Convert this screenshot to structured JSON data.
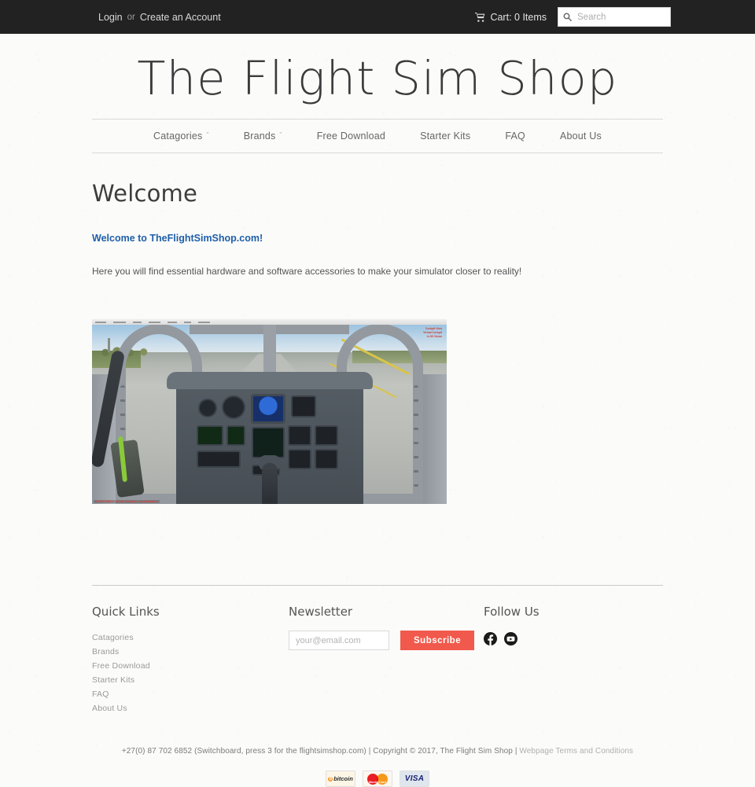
{
  "topbar": {
    "login_label": "Login",
    "separator": "or",
    "create_account_label": "Create an Account",
    "cart_label": "Cart: 0 Items",
    "cart_icon": "shopping-cart-icon",
    "search_icon": "search-icon",
    "search_placeholder": "Search",
    "search_value": "",
    "background_color": "#222222"
  },
  "brand": {
    "title": "The Flight Sim Shop"
  },
  "nav": {
    "items": [
      {
        "label": "Catagories",
        "has_caret": true,
        "caret": "ˇ"
      },
      {
        "label": "Brands",
        "has_caret": true,
        "caret": "ˇ"
      },
      {
        "label": "Free Download",
        "has_caret": false,
        "caret": ""
      },
      {
        "label": "Starter Kits",
        "has_caret": false,
        "caret": ""
      },
      {
        "label": "FAQ",
        "has_caret": false,
        "caret": ""
      },
      {
        "label": "About Us",
        "has_caret": false,
        "caret": ""
      }
    ]
  },
  "main": {
    "page_title": "Welcome",
    "lead_link": "Welcome to TheFlightSimShop.com!",
    "lead_link_color": "#1f5fa8",
    "intro_text": "Here you will find essential hardware and software accessories to make your simulator closer to reality!",
    "screenshot": {
      "alt": "Flight simulator jet cockpit view on runway",
      "watermark_top_right": "Cockpit View\nVirtual Cockpit\nin 3D Vision",
      "watermark_bottom_left": "FLIGHT SIM X  ·  Photo Realistic  ·  by Simulation",
      "menu_items": [
        "Flights",
        "Vehicles",
        "World",
        "Options",
        "Views",
        "Help",
        "Add-ons"
      ]
    }
  },
  "footer": {
    "quick_links": {
      "title": "Quick Links",
      "items": [
        "Catagories",
        "Brands",
        "Free Download",
        "Starter Kits",
        "FAQ",
        "About Us"
      ]
    },
    "newsletter": {
      "title": "Newsletter",
      "email_placeholder": "your@email.com",
      "email_value": "",
      "subscribe_label": "Subscribe",
      "subscribe_color": "#f0594b"
    },
    "follow": {
      "title": "Follow Us",
      "icons": [
        "facebook-icon",
        "youtube-icon"
      ]
    }
  },
  "bottom": {
    "phone_and_copyright": "+27(0) 87 702 6852 (Switchboard, press 3 for the flightsimshop.com) | Copyright © 2017, The Flight Sim Shop | ",
    "terms_label": "Webpage Terms and Conditions",
    "payments": [
      {
        "name": "bitcoin",
        "label": "bitcoin",
        "mark": "₿"
      },
      {
        "name": "mastercard",
        "label": "MasterCard",
        "mark": ""
      },
      {
        "name": "visa",
        "label": "VISA",
        "mark": ""
      }
    ]
  }
}
